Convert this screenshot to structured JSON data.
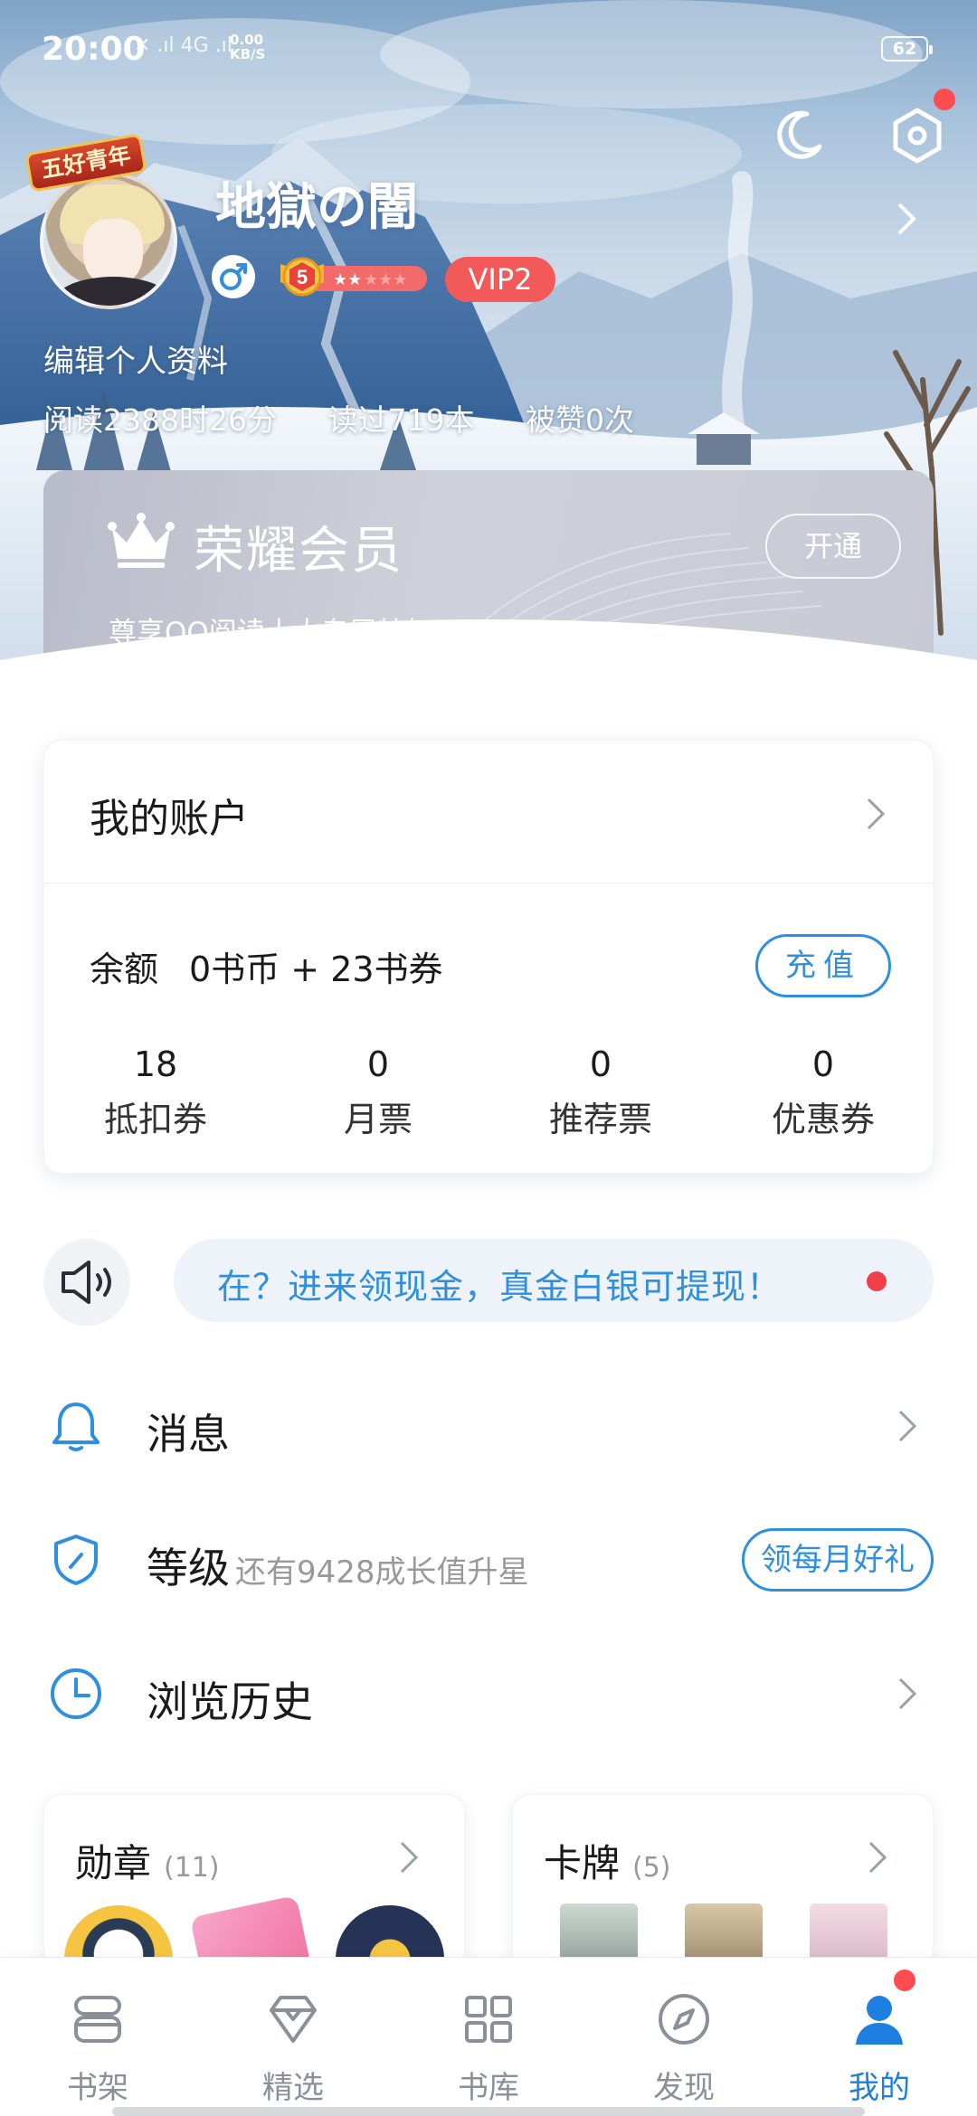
{
  "status_bar": {
    "time": "20:00",
    "signal": "✕ .ıl 4G .ıl",
    "speed_value": "0.00",
    "speed_unit": "KB/S",
    "battery": "62"
  },
  "profile": {
    "badge_title": "五好青年",
    "username": "地獄の闇",
    "level": "5",
    "vip": "VIP2",
    "edit_label": "编辑个人资料",
    "stats": {
      "read_time": "阅读2388时26分",
      "books_read": "读过719本",
      "likes": "被赞0次"
    }
  },
  "membership": {
    "title": "荣耀会员",
    "subtitle": "尊享QQ阅读十大专属特权",
    "button": "开通"
  },
  "account": {
    "title": "我的账户",
    "balance_label": "余额",
    "balance_value": "0书币 + 23书券",
    "recharge_button": "充值",
    "tickets": [
      {
        "value": "18",
        "name": "抵扣券"
      },
      {
        "value": "0",
        "name": "月票"
      },
      {
        "value": "0",
        "name": "推荐票"
      },
      {
        "value": "0",
        "name": "优惠券"
      }
    ]
  },
  "notice": {
    "text": "在？进来领现金，真金白银可提现！"
  },
  "menu": {
    "messages": "消息",
    "level_label": "等级",
    "level_hint": "还有9428成长值升星",
    "level_button": "领每月好礼",
    "history": "浏览历史"
  },
  "medals": {
    "title": "勋章",
    "count": "(11)"
  },
  "cards": {
    "title": "卡牌",
    "count": "(5)"
  },
  "tabbar": [
    {
      "label": "书架",
      "icon": "bookshelf-icon"
    },
    {
      "label": "精选",
      "icon": "diamond-icon"
    },
    {
      "label": "书库",
      "icon": "grid-icon"
    },
    {
      "label": "发现",
      "icon": "compass-icon"
    },
    {
      "label": "我的",
      "icon": "person-icon"
    }
  ],
  "colors": {
    "accent": "#2e8fe0",
    "tab_active": "#1e7fe0",
    "vip_badge": "#f25a5a",
    "red_dot": "#ff4d4f"
  }
}
